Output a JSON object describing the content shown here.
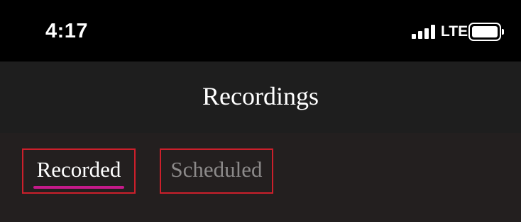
{
  "status_bar": {
    "time": "4:17",
    "network": "LTE",
    "signal_icon": "signal-bars-icon",
    "battery_icon": "battery-full-icon",
    "battery_level": 1.0
  },
  "header": {
    "title": "Recordings"
  },
  "tabs": [
    {
      "label": "Recorded",
      "selected": true
    },
    {
      "label": "Scheduled",
      "selected": false
    }
  ],
  "colors": {
    "background": "#231f1f",
    "header_background": "#1e1e1e",
    "status_bar_background": "#000000",
    "active_tab_indicator": "#c51a8a",
    "highlight_box": "#cc1f2b",
    "inactive_tab_text": "#8c8a8a"
  }
}
